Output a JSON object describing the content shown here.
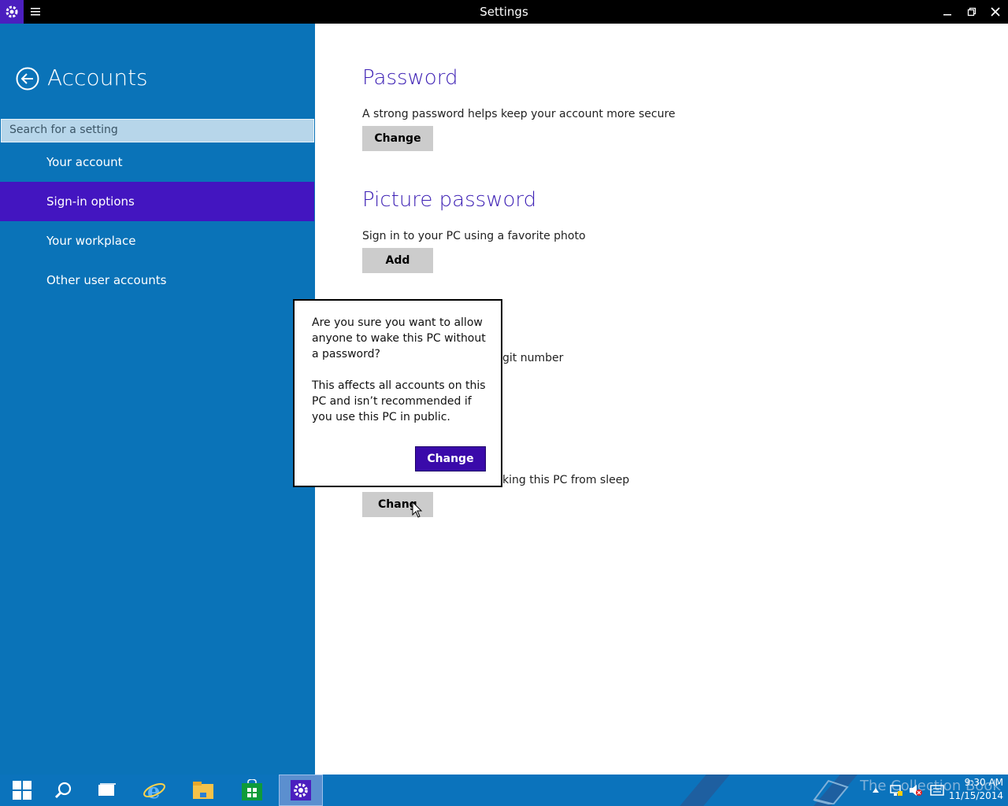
{
  "window": {
    "title": "Settings"
  },
  "sidebar": {
    "title": "Accounts",
    "search_placeholder": "Search for a setting",
    "items": [
      {
        "label": "Your account",
        "selected": false
      },
      {
        "label": "Sign-in options",
        "selected": true
      },
      {
        "label": "Your workplace",
        "selected": false
      },
      {
        "label": "Other user accounts",
        "selected": false
      }
    ]
  },
  "content": {
    "password": {
      "heading": "Password",
      "description": "A strong password helps keep your account more secure",
      "button": "Change"
    },
    "picture_password": {
      "heading": "Picture password",
      "description": "Sign in to your PC using a favorite photo",
      "button": "Add"
    },
    "pin": {
      "description_fragment": "git number"
    },
    "password_policy": {
      "description_fragment": "king this PC from sleep",
      "button": "Chang"
    }
  },
  "dialog": {
    "message_line1": "Are you sure you want to allow anyone to wake this PC without a password?",
    "message_line2": "This affects all accounts on this PC and isn’t recommended if you use this PC in public.",
    "confirm_label": "Change"
  },
  "taskbar": {
    "icons": [
      "windows-start-icon",
      "search-icon",
      "task-view-icon",
      "internet-explorer-icon",
      "file-explorer-icon",
      "store-icon",
      "settings-icon"
    ],
    "watermark": "The Collection Book",
    "time": "9:30 AM",
    "date": "11/15/2014"
  },
  "colors": {
    "sidebar_bg": "#0a73b8",
    "selected_nav": "#4315c0",
    "heading": "#3c1fb4",
    "dialog_button": "#3a0aaa"
  }
}
